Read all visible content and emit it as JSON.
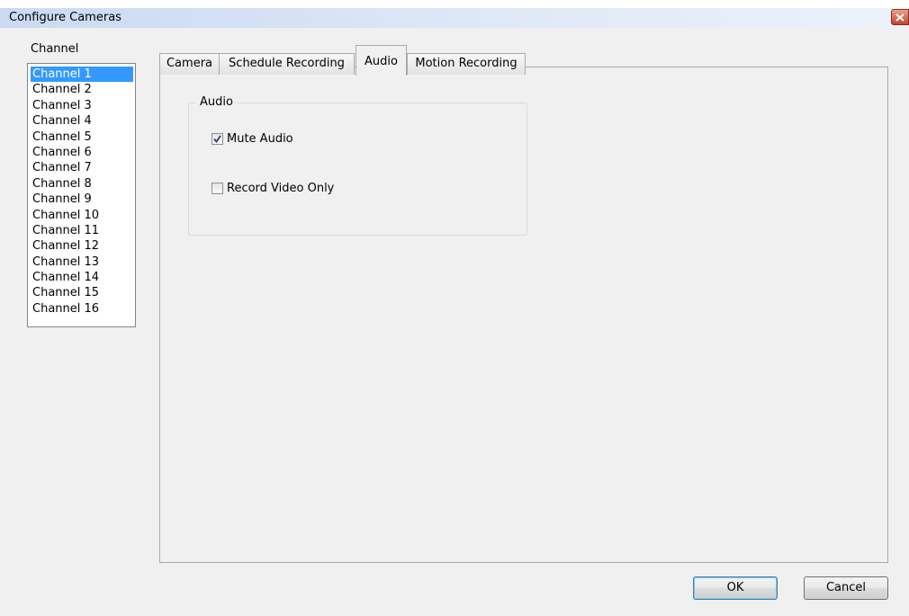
{
  "window": {
    "title": "Configure Cameras"
  },
  "channels": {
    "label": "Channel",
    "items": [
      "Channel 1",
      "Channel 2",
      "Channel 3",
      "Channel 4",
      "Channel 5",
      "Channel 6",
      "Channel 7",
      "Channel 8",
      "Channel 9",
      "Channel 10",
      "Channel 11",
      "Channel 12",
      "Channel 13",
      "Channel 14",
      "Channel 15",
      "Channel 16"
    ],
    "selected": "Channel 1"
  },
  "tabs": [
    {
      "label": "Camera",
      "active": false
    },
    {
      "label": "Schedule Recording",
      "active": false
    },
    {
      "label": "Audio",
      "active": true
    },
    {
      "label": "Motion Recording",
      "active": false
    }
  ],
  "audio_group": {
    "title": "Audio",
    "mute_audio": {
      "label": "Mute Audio",
      "checked": true
    },
    "record_video_only": {
      "label": "Record Video Only",
      "checked": false
    }
  },
  "buttons": {
    "ok": "OK",
    "cancel": "Cancel"
  },
  "colors": {
    "selection": "#3399ff",
    "titlebar": "#c9daf2",
    "close": "#c7442e"
  },
  "icons": {
    "close": "close-icon",
    "check": "checkmark-icon"
  }
}
